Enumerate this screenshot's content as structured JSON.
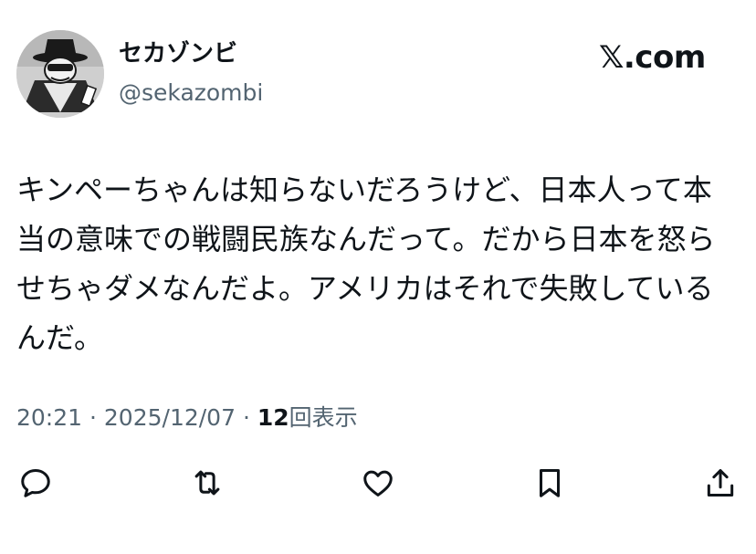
{
  "user": {
    "display_name": "セカゾンビ",
    "handle": "@sekazombi"
  },
  "brand": "𝕏.com",
  "tweet": {
    "text": "キンペーちゃんは知らないだろうけど、日本人って本当の意味での戦闘民族なんだって。だから日本を怒らせちゃダメなんだよ。アメリカはそれで失敗しているんだ。"
  },
  "meta": {
    "time": "20:21",
    "separator": "·",
    "date": "2025/12/07",
    "views_count": "12",
    "views_label": "回表示"
  },
  "actions": [
    {
      "icon": "reply-icon"
    },
    {
      "icon": "retweet-icon"
    },
    {
      "icon": "like-icon"
    },
    {
      "icon": "bookmark-icon"
    },
    {
      "icon": "share-icon"
    }
  ],
  "colors": {
    "text": "#0f1419",
    "secondary": "#536471",
    "background": "#ffffff"
  }
}
